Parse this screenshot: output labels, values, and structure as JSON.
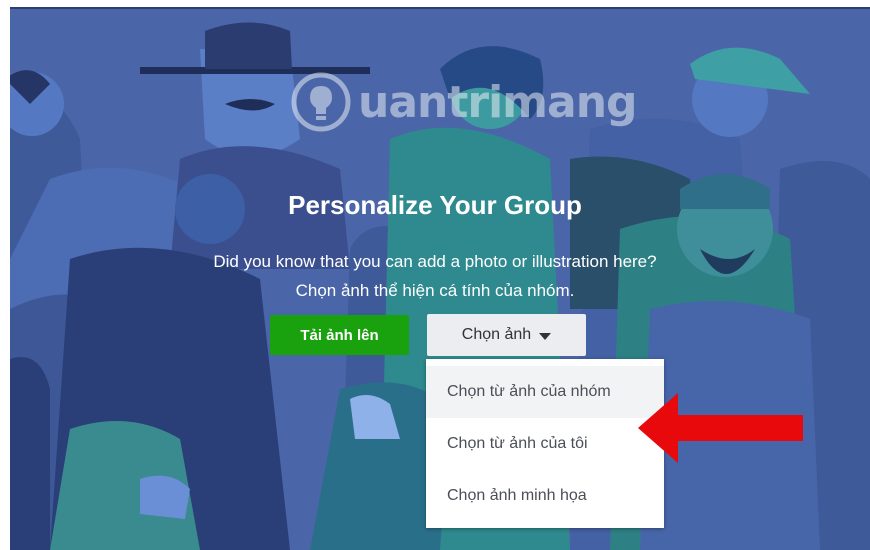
{
  "cover": {
    "background_color": "#4a66a8",
    "watermark_icon": "lightbulb-icon",
    "watermark_text": "uantrimang",
    "title": "Personalize Your Group",
    "subtitle_line1": "Did you know that you can add a photo or illustration here?",
    "subtitle_line2": "Chọn ảnh thể hiện cá tính của nhóm."
  },
  "buttons": {
    "upload_label": "Tải ảnh lên",
    "upload_color": "#1aa10e",
    "choose_label": "Chọn ảnh",
    "choose_icon": "caret-down-icon"
  },
  "dropdown": {
    "items": [
      {
        "label": "Chọn từ ảnh của nhóm"
      },
      {
        "label": "Chọn từ ảnh của tôi"
      },
      {
        "label": "Chọn ảnh minh họa"
      }
    ]
  },
  "annotation": {
    "arrow_icon": "red-arrow-icon",
    "arrow_color": "#e8090d"
  }
}
